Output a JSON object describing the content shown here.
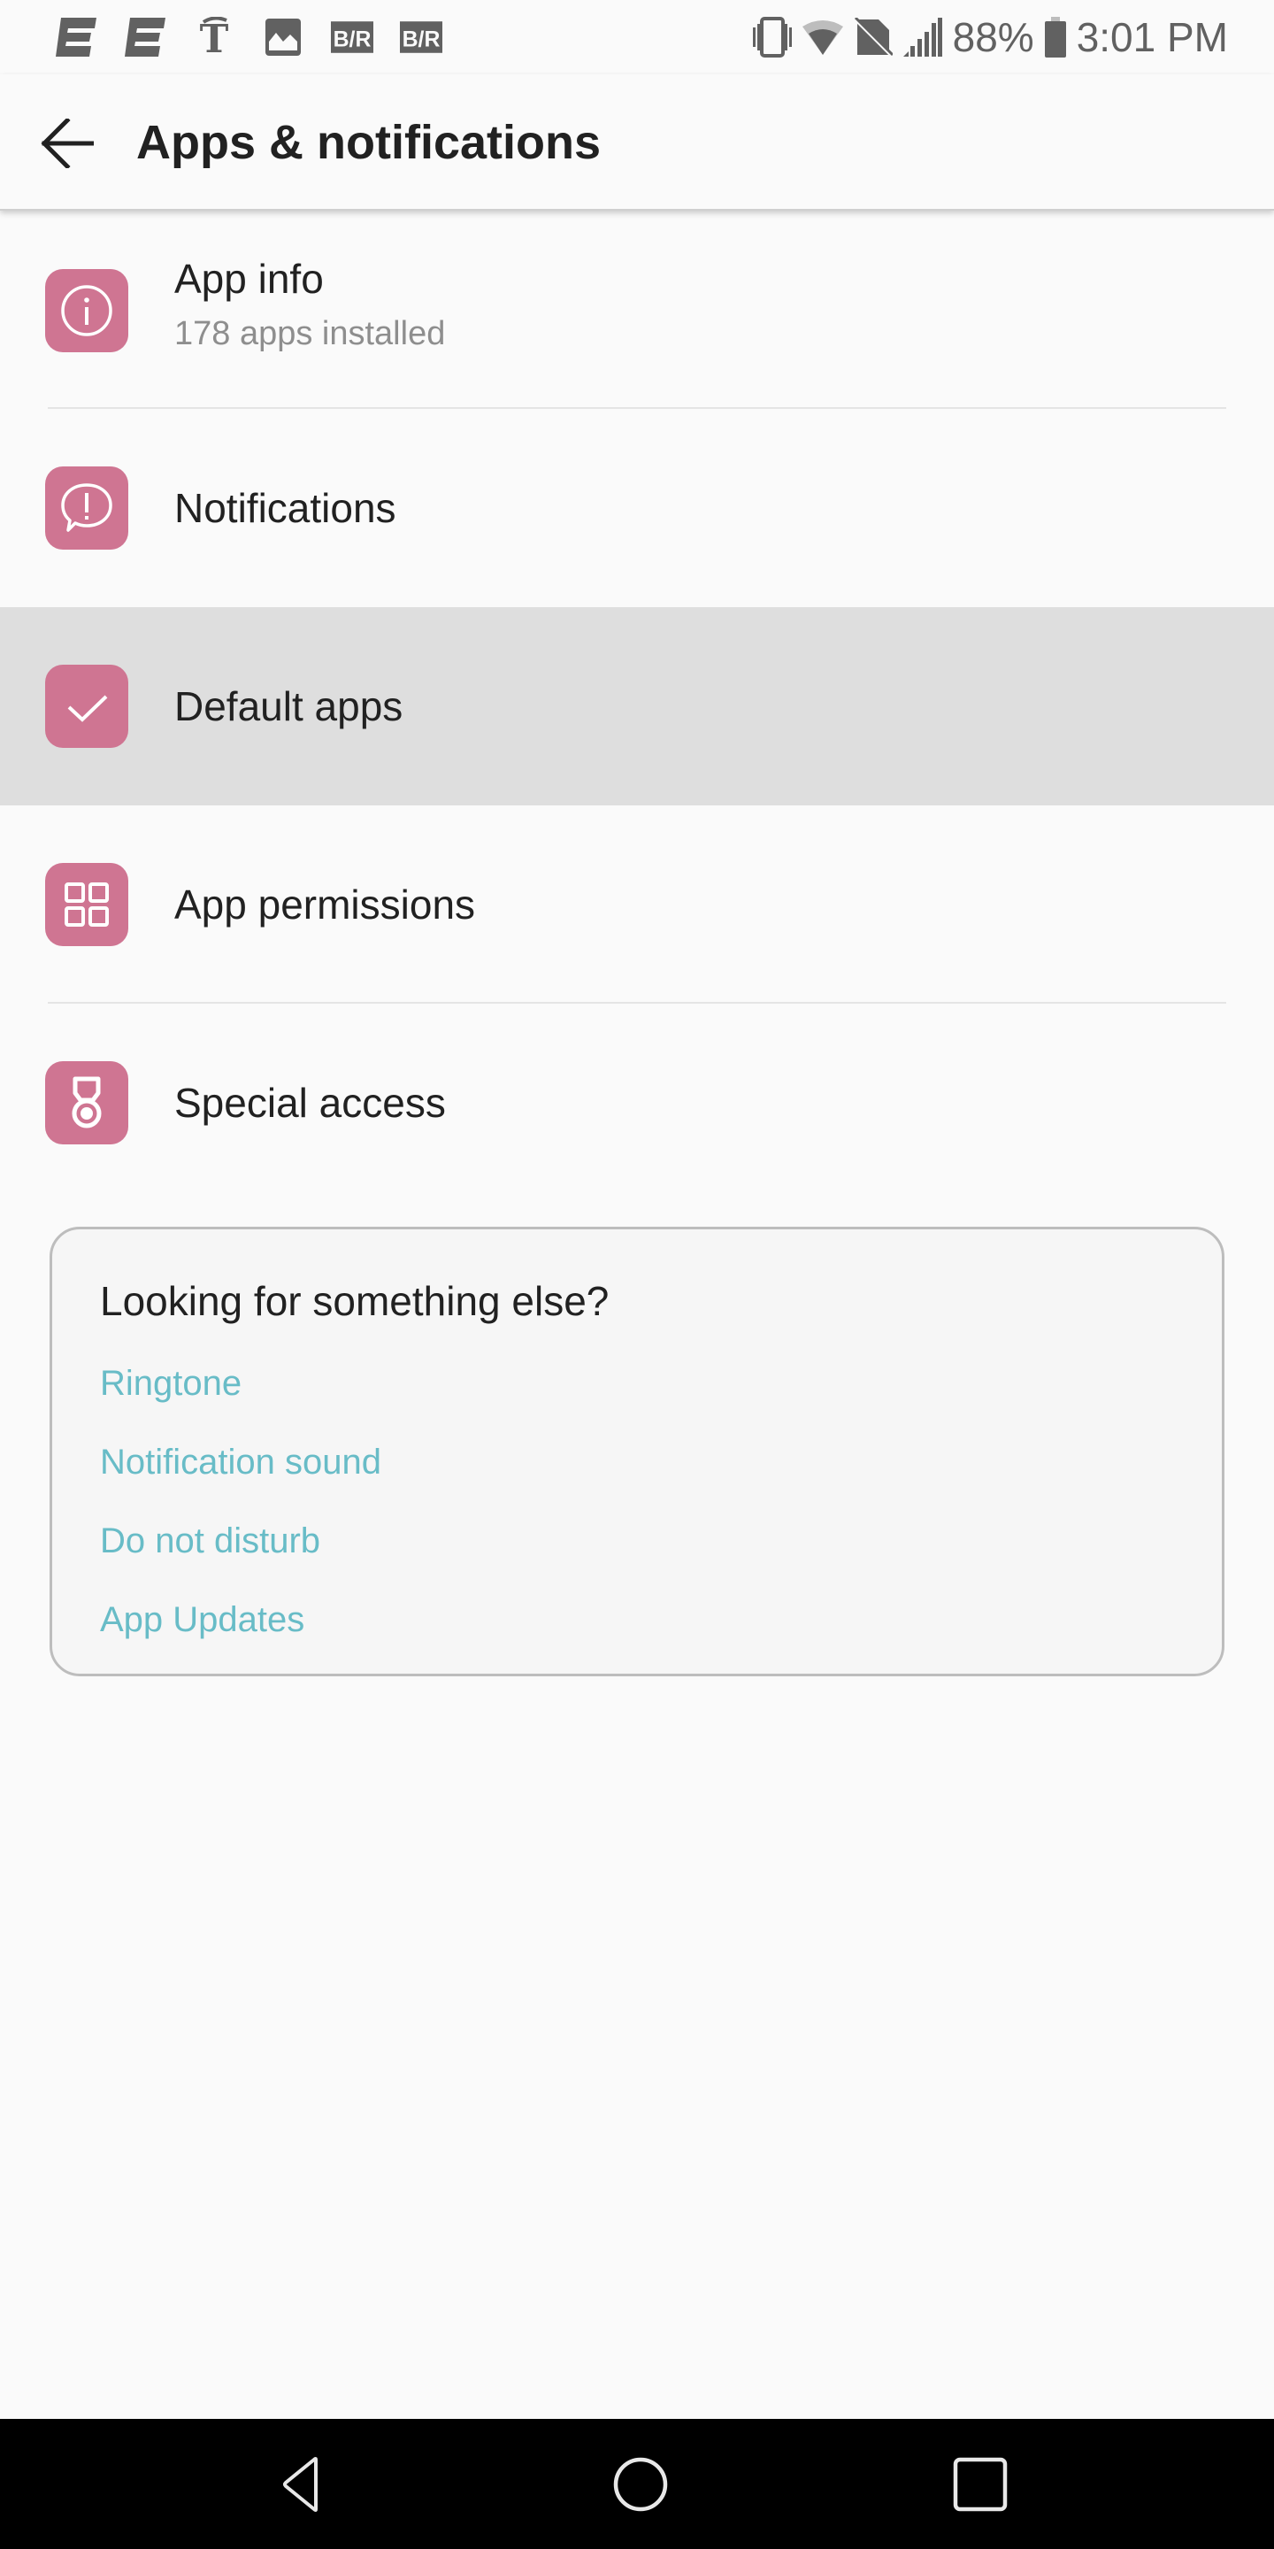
{
  "status_bar": {
    "notification_icons": [
      "espn-icon",
      "espn-icon",
      "nytimes-icon",
      "gallery-icon",
      "bleacher-report-icon",
      "bleacher-report-icon"
    ],
    "system_icons": [
      "vibrate-icon",
      "wifi-icon",
      "no-sim-icon",
      "signal-icon"
    ],
    "battery_percent": "88%",
    "battery_level": 0.88,
    "time": "3:01 PM"
  },
  "app_bar": {
    "back_icon": "arrow-left-icon",
    "title": "Apps & notifications"
  },
  "list": {
    "items": [
      {
        "id": "app-info",
        "label": "App info",
        "subtitle": "178 apps installed",
        "icon": "info-icon"
      },
      {
        "id": "notifications",
        "label": "Notifications",
        "icon": "chat-alert-icon"
      },
      {
        "id": "default-apps",
        "label": "Default apps",
        "icon": "check-icon",
        "pressed": true
      },
      {
        "id": "app-permissions",
        "label": "App permissions",
        "icon": "grid-icon"
      },
      {
        "id": "special-access",
        "label": "Special access",
        "icon": "medal-icon"
      }
    ],
    "icon_tile_color": "#cf7592"
  },
  "suggestions": {
    "title": "Looking for something else?",
    "links": [
      "Ringtone",
      "Notification sound",
      "Do not disturb",
      "App Updates"
    ],
    "link_color": "#68bcc7"
  },
  "nav_bar": {
    "buttons": [
      "back-icon",
      "home-icon",
      "recents-icon"
    ]
  }
}
